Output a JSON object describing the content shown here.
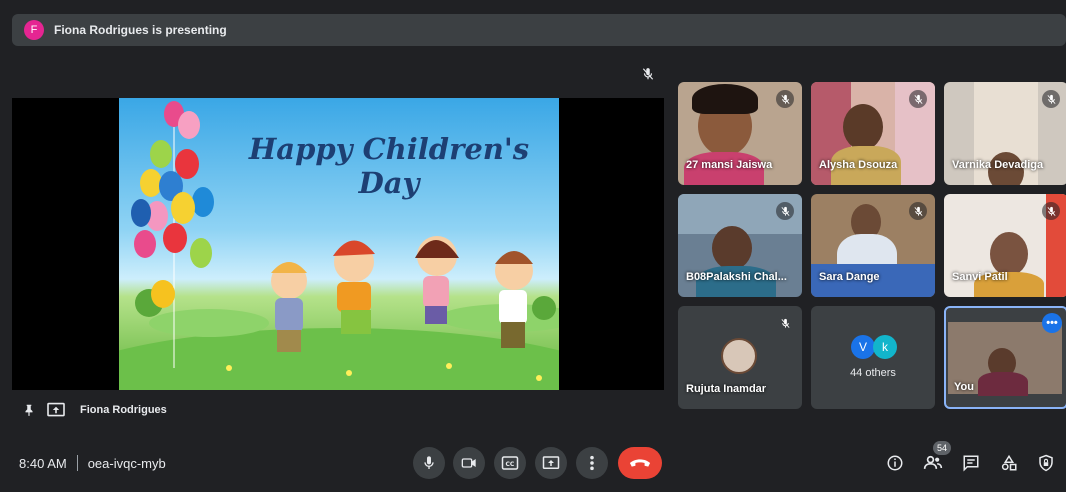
{
  "presenting_bar": {
    "avatar_initial": "F",
    "text": "Fiona Rodrigues is presenting"
  },
  "slide": {
    "title": "Happy Children's Day"
  },
  "stage": {
    "presenter_name": "Fiona Rodrigues"
  },
  "tiles": [
    {
      "name": "27 mansi Jaiswa",
      "muted": true
    },
    {
      "name": "Alysha Dsouza",
      "muted": true
    },
    {
      "name": "Varnika Devadiga",
      "muted": true
    },
    {
      "name": "B08Palakshi Chal...",
      "muted": true
    },
    {
      "name": "Sara Dange",
      "muted": true
    },
    {
      "name": "Sanvi Patil",
      "muted": true
    },
    {
      "name": "Rujuta Inamdar",
      "muted": true
    },
    {
      "others_initials": [
        "V",
        "k"
      ],
      "others_label": "44 others"
    },
    {
      "name": "You"
    }
  ],
  "bottom": {
    "time": "8:40 AM",
    "meeting_code": "oea-ivqc-myb",
    "people_count": "54"
  },
  "colors": {
    "background": "#202124",
    "end_call": "#ea4335",
    "accent": "#8ab4f8"
  }
}
